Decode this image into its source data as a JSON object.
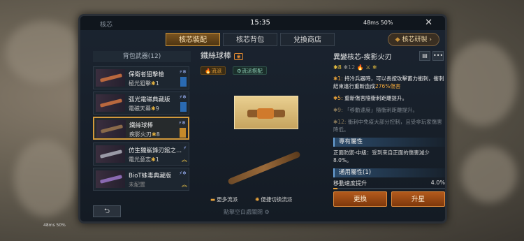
{
  "topbar": {
    "title": "核芯",
    "clock": "15:35",
    "status": "48ms 50%",
    "close_icon": "close-icon"
  },
  "tabs": [
    {
      "label": "核芯裝配",
      "active": true
    },
    {
      "label": "核芯背包",
      "active": false
    },
    {
      "label": "兌換商店",
      "active": false
    }
  ],
  "research_button": "核芯研製",
  "left_panel": {
    "header": "背包武器(12)",
    "weapons": [
      {
        "name": "保衛者狙擊槍",
        "sub": "極光狙擊",
        "stars": "1",
        "selected": false
      },
      {
        "name": "弧光電磁典藏版",
        "sub": "電磁天幕",
        "stars": "9",
        "selected": false
      },
      {
        "name": "鐵絲球棒",
        "sub": "疾影火刃",
        "stars": "8",
        "selected": true
      },
      {
        "name": "仿生獵鯊鋒刃館之...",
        "sub": "電光意志",
        "stars": "1",
        "selected": false
      },
      {
        "name": "BioT蛛毒典藏版",
        "sub": "未配置",
        "stars": "",
        "selected": false
      }
    ]
  },
  "center": {
    "weapon_name": "鐵絲球棒",
    "tag_gold": "流派",
    "tag_green": "流派搭配",
    "more_styles": "更多流派",
    "quick_switch": "便捷切換流派",
    "hint": "點擊空白處關閉"
  },
  "right": {
    "core_name": "異變核芯-疾影火刃",
    "star_count": "8",
    "max_star": "12",
    "perks": [
      {
        "num": "1",
        "text": "持冷兵器時，可以長按攻擊蓄力衝刺，衝刺結束進行重斬造成",
        "highlight": "276%傷害",
        "dim": false
      },
      {
        "num": "5",
        "text": "重新傷害隨衝刺距離提升。",
        "highlight": "",
        "dim": false
      },
      {
        "num": "9",
        "text": "「移動速度」隨衝刺距離提升。",
        "highlight": "",
        "dim": true
      },
      {
        "num": "12",
        "text": "衝刺中免疫大部分控制，且受非玩家傷害降低。",
        "highlight": "",
        "dim": true
      }
    ],
    "exclusive_title": "專有屬性",
    "exclusive_text": "正面防禦-中級：受到來自正面的傷害減少8.0%。",
    "general_title": "通用屬性(1)",
    "speed_label": "移動速度提升",
    "speed_value": "4.0%",
    "speed_fraction": 0.04,
    "replace_button": "更換",
    "upgrade_button": "升星"
  },
  "footer_status": "48ms 50%",
  "back_icon": "back-arrow-icon"
}
